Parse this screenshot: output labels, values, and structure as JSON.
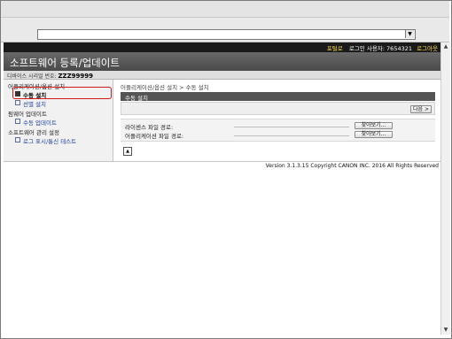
{
  "browser": {
    "address_dropdown_glyph": "▼",
    "scroll_up_glyph": "▲",
    "scroll_down_glyph": "▼"
  },
  "topbar": {
    "portal_link": "포털로",
    "login_user": "로그인 사용자: 7654321",
    "logout_link": "로그아웃"
  },
  "header": {
    "title": "소프트웨어 등록/업데이트"
  },
  "serial": {
    "label": "디바이스 시리얼 번호:",
    "value": "ZZZ99999"
  },
  "sidebar": {
    "sections": [
      {
        "title": "어플리케이션/옵션 설치",
        "items": [
          {
            "label": "수동 설치",
            "active": true
          },
          {
            "label": "선별 설치",
            "active": false
          }
        ]
      },
      {
        "title": "펌웨어 업데이트",
        "items": [
          {
            "label": "수동 업데이트",
            "active": false
          }
        ]
      },
      {
        "title": "소프트웨어 관리 설정",
        "items": [
          {
            "label": "로그 표시/통신 테스트",
            "active": false
          }
        ]
      }
    ]
  },
  "main": {
    "breadcrumb": "어플리케이션/옵션 설치 > 수동 설치",
    "panel_title": "수동 설치",
    "next_button": "다음 >",
    "fields": [
      {
        "label": "라이센스 파일 경로:",
        "button": "찾아보기..."
      },
      {
        "label": "어플리케이션 파일 경로:",
        "button": "찾아보기..."
      }
    ],
    "top_icon_glyph": "▲"
  },
  "footer": {
    "copyright": "Version 3.1.3.15 Copyright CANON INC. 2016 All Rights Reserved"
  },
  "colors": {
    "highlight": "#d21a1a",
    "topbar_bg": "#1a1a1a",
    "header_bg": "#555555",
    "panel_header_bg": "#545454",
    "link": "#1f3f9f",
    "top_link": "#ffdd55"
  }
}
